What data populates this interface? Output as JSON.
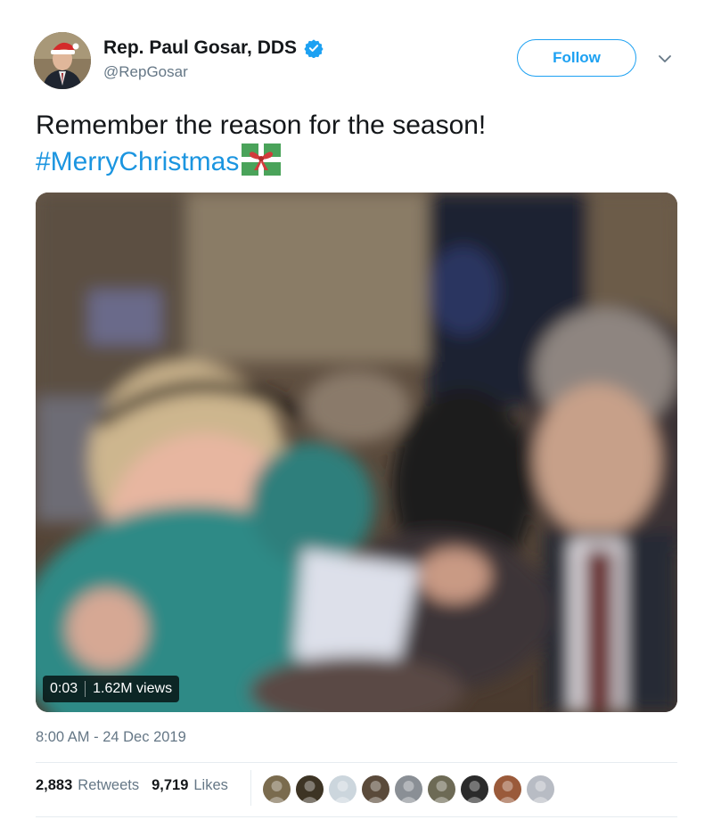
{
  "author": {
    "display_name": "Rep. Paul Gosar, DDS",
    "handle": "@RepGosar",
    "avatar_icon": "profile-photo-santa-hat",
    "verified_icon": "verified-badge-icon"
  },
  "follow_label": "Follow",
  "chevron_icon": "chevron-down-icon",
  "tweet": {
    "text": "Remember the reason for the season!",
    "hashtag": "#MerryChristmas",
    "emoji": "wrapped-gift-emoji"
  },
  "video": {
    "elapsed": "0:03",
    "views": "1.62M views"
  },
  "timestamp": "8:00 AM - 24 Dec 2019",
  "stats": {
    "retweets_count": "2,883",
    "retweets_label": "Retweets",
    "likes_count": "9,719",
    "likes_label": "Likes"
  },
  "colors": {
    "accent": "#1da1f2",
    "hashtag": "#1b95e0",
    "muted": "#657786",
    "divider": "#e6ecf0"
  },
  "likers": [
    {
      "icon": "liker-avatar-1",
      "color": "#7a6b4e"
    },
    {
      "icon": "liker-avatar-2",
      "color": "#3d3424"
    },
    {
      "icon": "liker-avatar-3",
      "color": "#ccd6dd"
    },
    {
      "icon": "liker-avatar-4",
      "color": "#5a4a3a"
    },
    {
      "icon": "liker-avatar-5",
      "color": "#8a8f95"
    },
    {
      "icon": "liker-avatar-6",
      "color": "#6d6a55"
    },
    {
      "icon": "liker-avatar-7",
      "color": "#2b2b2b"
    },
    {
      "icon": "liker-avatar-8",
      "color": "#9a5a3a"
    },
    {
      "icon": "liker-avatar-9",
      "color": "#b8bcc4"
    }
  ]
}
